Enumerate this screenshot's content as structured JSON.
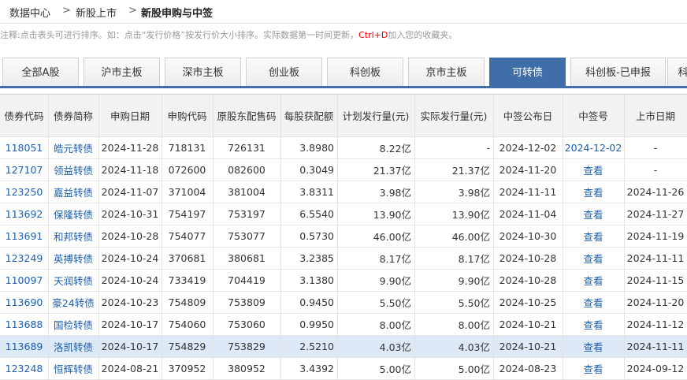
{
  "breadcrumb": {
    "items": [
      "数据中心",
      "新股上市",
      "新股申购与中签"
    ],
    "sep": ">"
  },
  "note": {
    "text_before": "注释:点击表头可进行排序。如：点击“发行价格”按发行价大小排序。实际数据第一时间更新，",
    "hotkey": "Ctrl+D",
    "text_after": "加入您的收藏夹。"
  },
  "tabs": [
    "全部A股",
    "沪市主板",
    "深市主板",
    "创业板",
    "科创板",
    "京市主板",
    "可转债",
    "科创板-已申报",
    "科"
  ],
  "active_tab": "可转债",
  "table": {
    "headers": [
      "债券代码",
      "债券简称",
      "申购日期",
      "申购代码",
      "原股东配售码",
      "每股获配额",
      "计划发行量(元)",
      "实际发行量(元)",
      "中签公布日",
      "中签号",
      "上市日期"
    ],
    "rows": [
      [
        "118051",
        "皓元转债",
        "2024-11-28",
        "718131",
        "726131",
        "3.8980",
        "8.22亿",
        "-",
        "2024-12-02",
        "2024-12-02",
        "-"
      ],
      [
        "127107",
        "领益转债",
        "2024-11-18",
        "072600",
        "082600",
        "0.3049",
        "21.37亿",
        "21.37亿",
        "2024-11-20",
        "查看",
        "-"
      ],
      [
        "123250",
        "嘉益转债",
        "2024-11-07",
        "371004",
        "381004",
        "3.8311",
        "3.98亿",
        "3.98亿",
        "2024-11-11",
        "查看",
        "2024-11-26"
      ],
      [
        "113692",
        "保隆转债",
        "2024-10-31",
        "754197",
        "753197",
        "6.5540",
        "13.90亿",
        "13.90亿",
        "2024-11-04",
        "查看",
        "2024-11-27"
      ],
      [
        "113691",
        "和邦转债",
        "2024-10-28",
        "754077",
        "753077",
        "0.5730",
        "46.00亿",
        "46.00亿",
        "2024-10-30",
        "查看",
        "2024-11-19"
      ],
      [
        "123249",
        "英搏转债",
        "2024-10-24",
        "370681",
        "380681",
        "3.2385",
        "8.17亿",
        "8.17亿",
        "2024-10-28",
        "查看",
        "2024-11-11"
      ],
      [
        "110097",
        "天润转债",
        "2024-10-24",
        "733419",
        "704419",
        "3.1380",
        "9.90亿",
        "9.90亿",
        "2024-10-28",
        "查看",
        "2024-11-15"
      ],
      [
        "113690",
        "豪24转债",
        "2024-10-23",
        "754809",
        "753809",
        "0.9450",
        "5.50亿",
        "5.50亿",
        "2024-10-25",
        "查看",
        "2024-11-20"
      ],
      [
        "113688",
        "国检转债",
        "2024-10-17",
        "754060",
        "753060",
        "0.9950",
        "8.00亿",
        "8.00亿",
        "2024-10-21",
        "查看",
        "2024-11-12"
      ],
      [
        "113689",
        "洛凯转债",
        "2024-10-17",
        "754829",
        "753829",
        "2.5210",
        "4.03亿",
        "4.03亿",
        "2024-10-21",
        "查看",
        "2024-11-11"
      ],
      [
        "123248",
        "恒辉转债",
        "2024-08-21",
        "370952",
        "380952",
        "3.4392",
        "5.00亿",
        "5.00亿",
        "2024-08-23",
        "查看",
        "2024-09-12"
      ]
    ],
    "highlight_row": 9
  },
  "colors": {
    "accent": "#3f6ea8",
    "link": "#1f5ea8",
    "hotkey": "#e00000",
    "highlight": "#dde9f6"
  }
}
